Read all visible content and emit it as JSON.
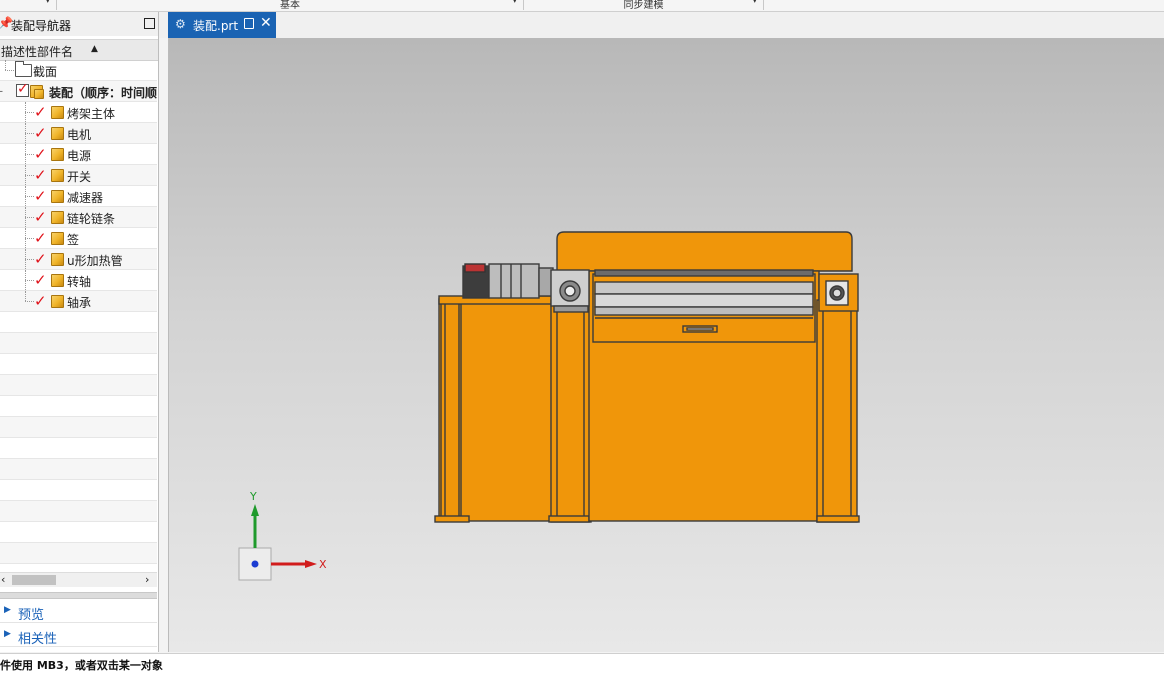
{
  "ribbon": {
    "groups": [
      {
        "label": "基本"
      },
      {
        "label": "同步建模"
      }
    ]
  },
  "navigator": {
    "title": "装配导航器",
    "column_header": "描述性部件名",
    "tree": [
      {
        "label": "截面",
        "icon": "folder-icon"
      },
      {
        "label": "装配（顺序：时间顺",
        "icon": "assembly-icon",
        "checked": true
      },
      {
        "label": "烤架主体",
        "icon": "part-cube-icon",
        "checked": true
      },
      {
        "label": "电机",
        "icon": "part-cube-icon",
        "checked": true
      },
      {
        "label": "电源",
        "icon": "part-cube-icon",
        "checked": true
      },
      {
        "label": "开关",
        "icon": "part-cube-icon",
        "checked": true
      },
      {
        "label": "减速器",
        "icon": "part-cube-icon",
        "checked": true
      },
      {
        "label": "链轮链条",
        "icon": "part-cube-icon",
        "checked": true
      },
      {
        "label": "签",
        "icon": "part-cube-icon",
        "checked": true
      },
      {
        "label": "u形加热管",
        "icon": "part-cube-icon",
        "checked": true
      },
      {
        "label": "转轴",
        "icon": "part-cube-icon",
        "checked": true
      },
      {
        "label": "轴承",
        "icon": "part-cube-icon",
        "checked": true
      }
    ],
    "panels": [
      {
        "label": "预览"
      },
      {
        "label": "相关性"
      }
    ]
  },
  "document_tab": {
    "label": "装配.prt"
  },
  "viewport": {
    "axis_x_label": "X",
    "axis_y_label": "Y",
    "model_color": "#F0960A",
    "outline_color": "#3a3a3a"
  },
  "status": {
    "message": "件使用 MB3，或者双击某一对象"
  }
}
